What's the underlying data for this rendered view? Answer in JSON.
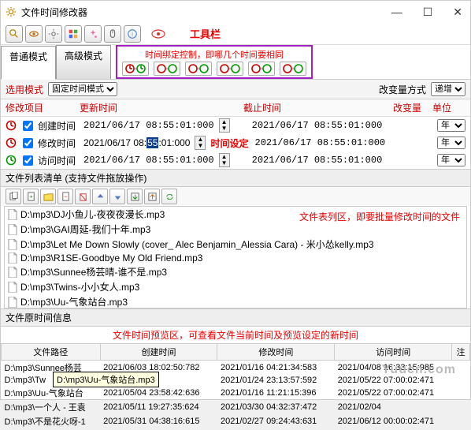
{
  "window": {
    "title": "文件时间修改器"
  },
  "toolbar": {
    "label": "工具栏"
  },
  "tabs": {
    "normal": "普通模式",
    "advanced": "高级模式"
  },
  "mode": {
    "label": "选用模式",
    "value": "固定时间模式",
    "change_label": "改变量方式",
    "change_value": "递增"
  },
  "bind": {
    "label": "时间绑定控制，即哪几个时间要相同"
  },
  "headers": {
    "item": "修改项目",
    "update": "更新时间",
    "cutoff": "截止时间",
    "delta": "改变量",
    "unit": "单位"
  },
  "times": {
    "create": {
      "label": "创建时间",
      "checked": true,
      "update": "2021/06/17  08:55:01:000",
      "cutoff": "2021/06/17  08:55:01:000",
      "unit": "年"
    },
    "modify": {
      "label": "修改时间",
      "checked": true,
      "update_pre": "2021/06/17  08:",
      "update_hl": "55",
      "update_post": ":01:000",
      "cutoff": "2021/06/17  08:55:01:000",
      "unit": "年",
      "anno": "时间设定"
    },
    "access": {
      "label": "访问时间",
      "checked": true,
      "update": "2021/06/17  08:55:01:000",
      "cutoff": "2021/06/17  08:55:01:000",
      "unit": "年"
    }
  },
  "filelist": {
    "header": "文件列表清单  (支持文件拖放操作)",
    "anno": "文件表列区，即要批量修改时间的文件",
    "items": [
      "D:\\mp3\\DJ小鱼儿-夜夜夜漫长.mp3",
      "D:\\mp3\\GAI周延-我们十年.mp3",
      "D:\\mp3\\Let Me Down Slowly (cover_ Alec Benjamin_Alessia Cara) - 米小怂kelly.mp3",
      "D:\\mp3\\R1SE-Goodbye My Old Friend.mp3",
      "D:\\mp3\\Sunnee杨芸晴-谁不是.mp3",
      "D:\\mp3\\Twins-小小女人.mp3",
      "D:\\mp3\\Uu-气象站台.mp3"
    ]
  },
  "preview": {
    "header": "文件原时间信息",
    "anno": "文件时间预览区，可查看文件当前时间及预览设定的新时间",
    "cols": {
      "path": "文件路径",
      "create": "创建时间",
      "modify": "修改时间",
      "access": "访问时间",
      "note": "注"
    },
    "tooltip": "D:\\mp3\\Uu-气象站台.mp3",
    "rows": [
      {
        "path": "D:\\mp3\\Sunnee杨芸",
        "create": "2021/06/03 18:02:50:782",
        "modify": "2021/01/16 04:21:34:583",
        "access": "2021/04/08 16:33:15:985"
      },
      {
        "path": "D:\\mp3\\Tw",
        "create": "41:01:280",
        "modify": "2021/01/24 23:13:57:592",
        "access": "2021/05/22 07:00:02:471"
      },
      {
        "path": "D:\\mp3\\Uu-气象站台",
        "create": "2021/05/04 23:58:42:636",
        "modify": "2021/01/16 11:21:15:396",
        "access": "2021/05/22 07:00:02:471"
      },
      {
        "path": "D:\\mp3\\一个人 - 王袁",
        "create": "2021/05/11 19:27:35:624",
        "modify": "2021/03/30 04:32:37:472",
        "access": "2021/02/04"
      },
      {
        "path": "D:\\mp3\\不是花火呀-1",
        "create": "2021/05/31 04:38:16:615",
        "modify": "2021/02/27 09:24:43:631",
        "access": "2021/06/12 00:00:02:471"
      }
    ]
  },
  "watermark": "Yuucn.com"
}
